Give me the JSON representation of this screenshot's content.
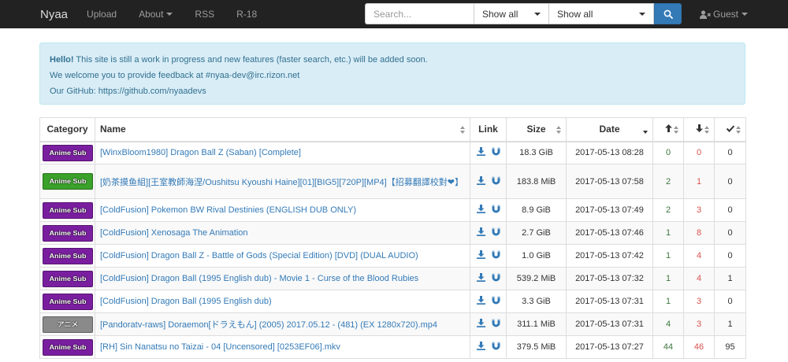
{
  "navbar": {
    "brand": "Nyaa",
    "links": [
      "Upload",
      "About",
      "RSS",
      "R-18"
    ],
    "search_placeholder": "Search...",
    "filter_select": "Show all",
    "category_select": "Show all",
    "user": "Guest"
  },
  "alert": {
    "strong": "Hello!",
    "line1": " This site is still a work in progress and new features (faster search, etc.) will be added soon.",
    "line2": "We welcome you to provide feedback at #nyaa-dev@irc.rizon.net",
    "line3": "Our GitHub: https://github.com/nyaadevs"
  },
  "table": {
    "headers": {
      "category": "Category",
      "name": "Name",
      "link": "Link",
      "size": "Size",
      "date": "Date"
    },
    "rows": [
      {
        "category": "Anime Sub",
        "cat_color": "#7a1ea0",
        "name": "[WinxBloom1980] Dragon Ball Z (Saban) [Complete]",
        "size": "18.3 GiB",
        "date": "2017-05-13 08:28",
        "seeders": "0",
        "leechers": "0",
        "completed": "0"
      },
      {
        "category": "Anime Sub",
        "cat_color": "#3aa12a",
        "name": "[奶茶摸鱼組][王室教師海涅/Oushitsu Kyoushi Haine][01][BIG5][720P][MP4]【招募翻譯校對❤】",
        "size": "183.8 MiB",
        "date": "2017-05-13 07:58",
        "seeders": "2",
        "leechers": "1",
        "completed": "0"
      },
      {
        "category": "Anime Sub",
        "cat_color": "#7a1ea0",
        "name": "[ColdFusion] Pokemon BW Rival Destinies (ENGLISH DUB ONLY)",
        "size": "8.9 GiB",
        "date": "2017-05-13 07:49",
        "seeders": "2",
        "leechers": "3",
        "completed": "0"
      },
      {
        "category": "Anime Sub",
        "cat_color": "#7a1ea0",
        "name": "[ColdFusion] Xenosaga The Animation",
        "size": "2.7 GiB",
        "date": "2017-05-13 07:46",
        "seeders": "1",
        "leechers": "8",
        "completed": "0"
      },
      {
        "category": "Anime Sub",
        "cat_color": "#7a1ea0",
        "name": "[ColdFusion] Dragon Ball Z - Battle of Gods (Special Edition) [DVD] (DUAL AUDIO)",
        "size": "1.0 GiB",
        "date": "2017-05-13 07:42",
        "seeders": "1",
        "leechers": "4",
        "completed": "0"
      },
      {
        "category": "Anime Sub",
        "cat_color": "#7a1ea0",
        "name": "[ColdFusion] Dragon Ball (1995 English dub) - Movie 1 - Curse of the Blood Rubies",
        "size": "539.2 MiB",
        "date": "2017-05-13 07:32",
        "seeders": "1",
        "leechers": "4",
        "completed": "1"
      },
      {
        "category": "Anime Sub",
        "cat_color": "#7a1ea0",
        "name": "[ColdFusion] Dragon Ball (1995 English dub)",
        "size": "3.3 GiB",
        "date": "2017-05-13 07:31",
        "seeders": "1",
        "leechers": "3",
        "completed": "0"
      },
      {
        "category": "アニメ",
        "cat_color": "#8a8a8a",
        "name": "[Pandoratv-raws] Doraemon[ドラえもん] (2005) 2017.05.12 - (481) (EX 1280x720).mp4",
        "size": "311.1 MiB",
        "date": "2017-05-13 07:31",
        "seeders": "4",
        "leechers": "3",
        "completed": "1"
      },
      {
        "category": "Anime Sub",
        "cat_color": "#7a1ea0",
        "name": "[RH] Sin Nanatsu no Taizai - 04 [Uncensored] [0253EF06].mkv",
        "size": "379.5 MiB",
        "date": "2017-05-13 07:27",
        "seeders": "44",
        "leechers": "46",
        "completed": "95"
      }
    ]
  }
}
